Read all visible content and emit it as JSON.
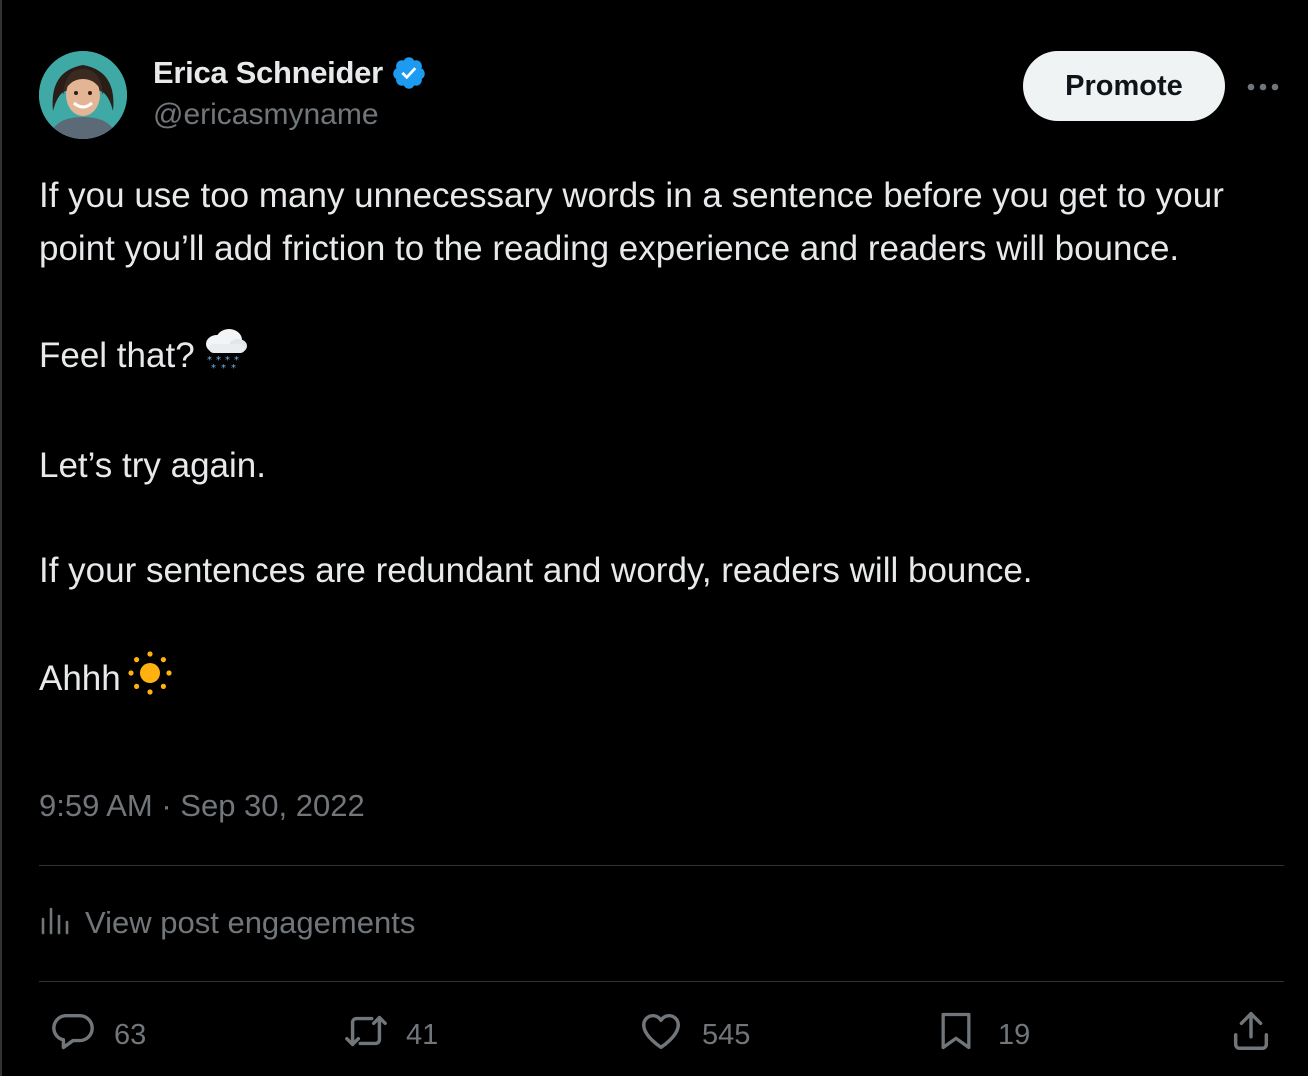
{
  "author": {
    "display_name": "Erica Schneider",
    "handle": "@ericasmyname",
    "verified": true,
    "verified_color": "#1d9bf0"
  },
  "header": {
    "promote_label": "Promote",
    "more_icon": "more-horizontal-icon"
  },
  "tweet": {
    "paragraphs": [
      "If you use too many unnecessary words in a sentence before you get to your point you’ll add friction to the reading experience and readers will bounce.",
      "Feel that?",
      "Let’s try again.",
      "If your sentences are redundant and wordy, readers will bounce.",
      "Ahhh"
    ],
    "emoji_1": "snow-cloud-emoji",
    "emoji_2": "sun-emoji",
    "timestamp": "9:59 AM · Sep 30, 2022"
  },
  "engagements": {
    "label": "View post engagements",
    "icon": "analytics-bars-icon"
  },
  "actions": {
    "replies": "63",
    "reposts": "41",
    "likes": "545",
    "bookmarks": "19"
  },
  "colors": {
    "background": "#000000",
    "text_primary": "#e7e9ea",
    "text_secondary": "#71767b",
    "divider": "#2f3336",
    "promote_bg": "#eff3f4"
  }
}
